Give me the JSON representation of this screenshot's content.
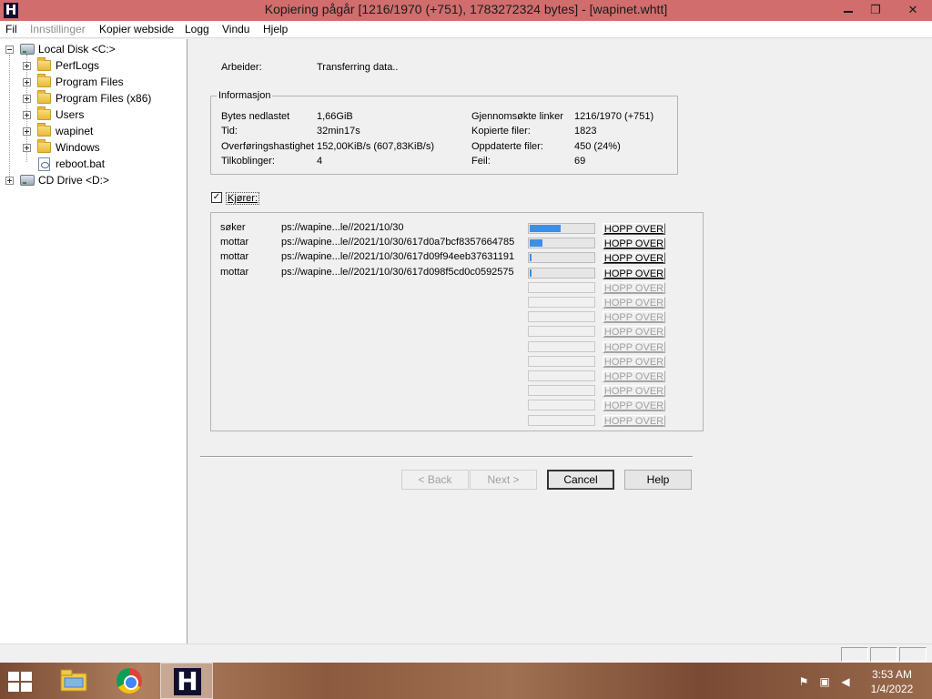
{
  "window": {
    "title": "Kopiering pågår [1216/1970 (+751), 1783272324 bytes] - [wapinet.whtt]",
    "app_icon_letter": "H",
    "restore_glyph": "❐",
    "close_glyph": "✕"
  },
  "menu": {
    "items": [
      {
        "label": "Fil",
        "enabled": true
      },
      {
        "label": "Innstillinger",
        "enabled": false
      },
      {
        "label": "Kopier webside",
        "enabled": true
      },
      {
        "label": "Logg",
        "enabled": true
      },
      {
        "label": "Vindu",
        "enabled": true
      },
      {
        "label": "Hjelp",
        "enabled": true
      }
    ]
  },
  "tree": {
    "root": "Local Disk <C:>",
    "children": [
      "PerfLogs",
      "Program Files",
      "Program Files (x86)",
      "Users",
      "wapinet",
      "Windows",
      "reboot.bat"
    ],
    "second": "CD Drive <D:>"
  },
  "dialog": {
    "worker_label": "Arbeider:",
    "worker_value": "Transferring data..",
    "info_title": "Informasjon",
    "info_left": [
      {
        "label": "Bytes nedlastet",
        "value": "1,66GiB"
      },
      {
        "label": "Tid:",
        "value": "32min17s"
      },
      {
        "label": "Overføringshastighet",
        "value": "152,00KiB/s (607,83KiB/s)"
      },
      {
        "label": "Tilkoblinger:",
        "value": "4"
      }
    ],
    "info_right": [
      {
        "label": "Gjennomsøkte linker",
        "value": "1216/1970 (+751)"
      },
      {
        "label": "Kopierte filer:",
        "value": "1823"
      },
      {
        "label": "Oppdaterte filer:",
        "value": "450 (24%)"
      },
      {
        "label": "Feil:",
        "value": "69"
      }
    ],
    "running_label": "Kjører:",
    "running_checked": true,
    "check_glyph": "✓",
    "skip_label": "HOPP OVER",
    "transfers": [
      {
        "status": "søker",
        "url": "ps://wapine...le//2021/10/30",
        "progress": 0.48
      },
      {
        "status": "mottar",
        "url": "ps://wapine...le//2021/10/30/617d0a7bcf8357664785",
        "progress": 0.2
      },
      {
        "status": "mottar",
        "url": "ps://wapine...le//2021/10/30/617d09f94eeb37631191",
        "progress": 0.03
      },
      {
        "status": "mottar",
        "url": "ps://wapine...le//2021/10/30/617d098f5cd0c0592575",
        "progress": 0.02
      }
    ],
    "inactive_slots": 10,
    "buttons": {
      "back": "< Back",
      "next": "Next >",
      "cancel": "Cancel",
      "help": "Help"
    }
  },
  "taskbar": {
    "time": "3:53 AM",
    "date": "1/4/2022",
    "task_letter": "H",
    "tray": {
      "flag_glyph": "⚑",
      "network_glyph": "▣",
      "volume_glyph": "◀"
    }
  },
  "colors": {
    "titlebar": "#d16d6d",
    "progress_fill": "#3c8ee8"
  }
}
